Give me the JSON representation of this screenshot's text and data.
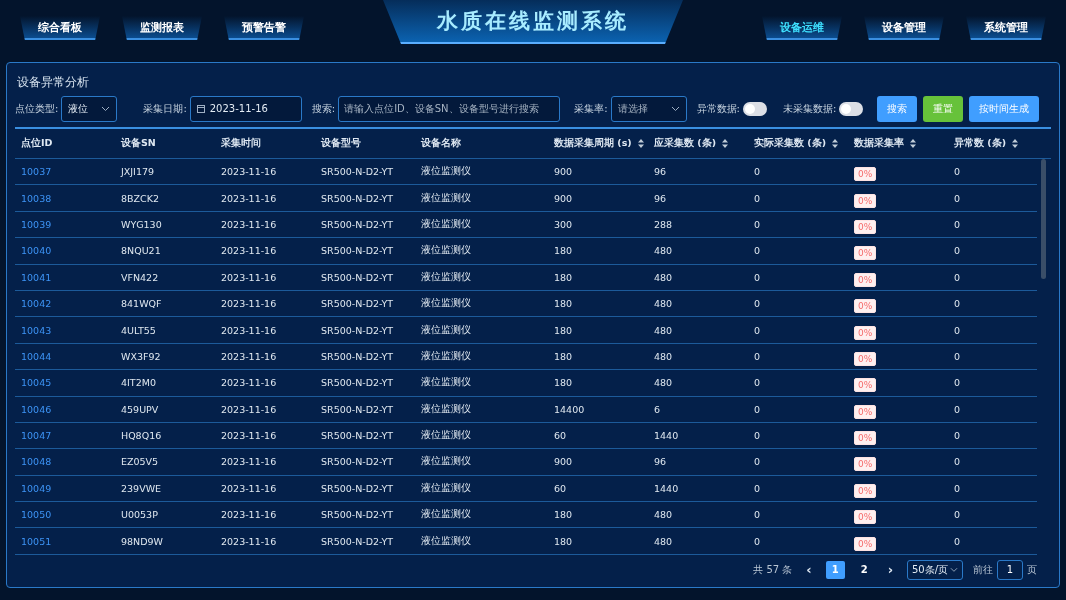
{
  "nav": {
    "left": [
      {
        "label": "综合看板",
        "selected": false
      },
      {
        "label": "监测报表",
        "selected": false
      },
      {
        "label": "预警告警",
        "selected": false
      }
    ],
    "title": "水质在线监测系统",
    "right": [
      {
        "label": "设备运维",
        "selected": true
      },
      {
        "label": "设备管理",
        "selected": false
      },
      {
        "label": "系统管理",
        "selected": false
      }
    ]
  },
  "panel": {
    "title": "设备异常分析"
  },
  "filters": {
    "point_type": {
      "label": "点位类型:",
      "value": "液位"
    },
    "date": {
      "label": "采集日期:",
      "value": "2023-11-16"
    },
    "search": {
      "label": "搜索:",
      "placeholder": "请输入点位ID、设备SN、设备型号进行搜索"
    },
    "rate": {
      "label": "采集率:",
      "placeholder": "请选择"
    },
    "abnormal": {
      "label": "异常数据:",
      "on": false
    },
    "uncollected": {
      "label": "未采集数据:",
      "on": false
    },
    "buttons": [
      {
        "label": "搜索",
        "kind": "primary"
      },
      {
        "label": "重置",
        "kind": "success"
      },
      {
        "label": "按时间生成",
        "kind": "primary"
      }
    ]
  },
  "table": {
    "columns": [
      {
        "label": "点位ID",
        "kind": "link",
        "sortable": false
      },
      {
        "label": "设备SN",
        "kind": "text",
        "sortable": false
      },
      {
        "label": "采集时间",
        "kind": "text",
        "sortable": false
      },
      {
        "label": "设备型号",
        "kind": "text",
        "sortable": false
      },
      {
        "label": "设备名称",
        "kind": "text",
        "sortable": false
      },
      {
        "label": "数据采集周期 (s)",
        "kind": "text",
        "sortable": true
      },
      {
        "label": "应采集数 (条)",
        "kind": "text",
        "sortable": true
      },
      {
        "label": "实际采集数 (条)",
        "kind": "text",
        "sortable": true
      },
      {
        "label": "数据采集率",
        "kind": "tag",
        "sortable": true
      },
      {
        "label": "异常数 (条)",
        "kind": "text",
        "sortable": true
      }
    ],
    "rows": [
      [
        "10037",
        "JXJI179",
        "2023-11-16",
        "SR500-N-D2-YT",
        "液位监测仪",
        "900",
        "96",
        "0",
        "0%",
        "0"
      ],
      [
        "10038",
        "8BZCK2",
        "2023-11-16",
        "SR500-N-D2-YT",
        "液位监测仪",
        "900",
        "96",
        "0",
        "0%",
        "0"
      ],
      [
        "10039",
        "WYG130",
        "2023-11-16",
        "SR500-N-D2-YT",
        "液位监测仪",
        "300",
        "288",
        "0",
        "0%",
        "0"
      ],
      [
        "10040",
        "8NQU21",
        "2023-11-16",
        "SR500-N-D2-YT",
        "液位监测仪",
        "180",
        "480",
        "0",
        "0%",
        "0"
      ],
      [
        "10041",
        "VFN422",
        "2023-11-16",
        "SR500-N-D2-YT",
        "液位监测仪",
        "180",
        "480",
        "0",
        "0%",
        "0"
      ],
      [
        "10042",
        "841WQF",
        "2023-11-16",
        "SR500-N-D2-YT",
        "液位监测仪",
        "180",
        "480",
        "0",
        "0%",
        "0"
      ],
      [
        "10043",
        "4ULT55",
        "2023-11-16",
        "SR500-N-D2-YT",
        "液位监测仪",
        "180",
        "480",
        "0",
        "0%",
        "0"
      ],
      [
        "10044",
        "WX3F92",
        "2023-11-16",
        "SR500-N-D2-YT",
        "液位监测仪",
        "180",
        "480",
        "0",
        "0%",
        "0"
      ],
      [
        "10045",
        "4IT2M0",
        "2023-11-16",
        "SR500-N-D2-YT",
        "液位监测仪",
        "180",
        "480",
        "0",
        "0%",
        "0"
      ],
      [
        "10046",
        "459UPV",
        "2023-11-16",
        "SR500-N-D2-YT",
        "液位监测仪",
        "14400",
        "6",
        "0",
        "0%",
        "0"
      ],
      [
        "10047",
        "HQ8Q16",
        "2023-11-16",
        "SR500-N-D2-YT",
        "液位监测仪",
        "60",
        "1440",
        "0",
        "0%",
        "0"
      ],
      [
        "10048",
        "EZ05V5",
        "2023-11-16",
        "SR500-N-D2-YT",
        "液位监测仪",
        "900",
        "96",
        "0",
        "0%",
        "0"
      ],
      [
        "10049",
        "239VWE",
        "2023-11-16",
        "SR500-N-D2-YT",
        "液位监测仪",
        "60",
        "1440",
        "0",
        "0%",
        "0"
      ],
      [
        "10050",
        "U0053P",
        "2023-11-16",
        "SR500-N-D2-YT",
        "液位监测仪",
        "180",
        "480",
        "0",
        "0%",
        "0"
      ],
      [
        "10051",
        "98ND9W",
        "2023-11-16",
        "SR500-N-D2-YT",
        "液位监测仪",
        "180",
        "480",
        "0",
        "0%",
        "0"
      ]
    ]
  },
  "pagination": {
    "total": "共 57 条",
    "prev": "‹",
    "pages": [
      {
        "label": "1",
        "selected": true
      },
      {
        "label": "2",
        "selected": false
      }
    ],
    "next": "›",
    "page_size": "50条/页",
    "goto_label": "前往",
    "goto_value": "1",
    "goto_suffix": "页"
  }
}
